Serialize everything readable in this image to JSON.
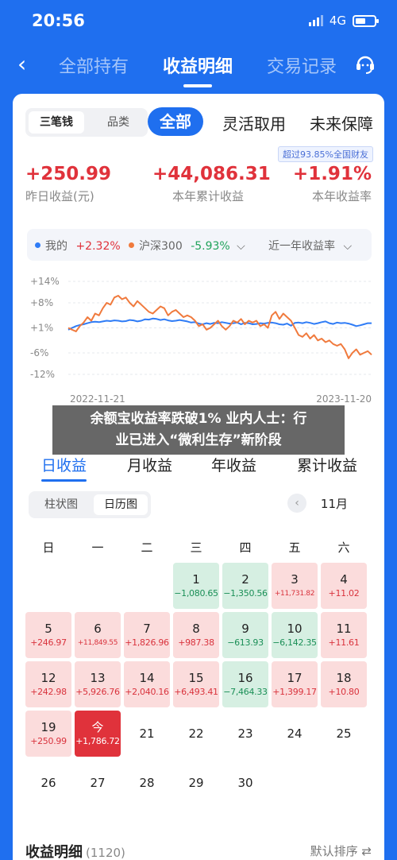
{
  "status": {
    "time": "20:56",
    "network": "4G"
  },
  "nav": {
    "tabs": [
      "全部持有",
      "收益明细",
      "交易记录"
    ],
    "active": 1
  },
  "segment": {
    "options": [
      "三笔钱",
      "品类"
    ],
    "selected": 0
  },
  "filters": [
    "全部",
    "灵活取用",
    "未来保障"
  ],
  "rank_badge": "超过93.85%全国财友",
  "stats": [
    {
      "value": "+250.99",
      "label": "昨日收益(元)"
    },
    {
      "value": "+44,086.31",
      "label": "本年累计收益"
    },
    {
      "value": "+1.91%",
      "label": "本年收益率"
    }
  ],
  "legend": {
    "mine_label": "我的",
    "mine_value": "+2.32%",
    "index_label": "沪深300",
    "index_value": "-5.93%",
    "period": "近一年收益率"
  },
  "colors": {
    "primary": "#1f6fef",
    "up": "#e0323b",
    "down": "#21a35b",
    "mine_line": "#2f7cf6",
    "index_line": "#f07a3d"
  },
  "chart_data": {
    "type": "line",
    "y_ticks": [
      "+14%",
      "+8%",
      "+1%",
      "-6%",
      "-12%"
    ],
    "y_tick_values": [
      14,
      8,
      1,
      -6,
      -12
    ],
    "ylim": [
      -12,
      14
    ],
    "x_labels": [
      "2022-11-21",
      "2023-11-20"
    ],
    "series": [
      {
        "name": "我的",
        "values": [
          0.5,
          1.0,
          1.5,
          1.8,
          2.0,
          2.3,
          2.6,
          2.7,
          2.6,
          2.8,
          3.0,
          2.9,
          3.1,
          3.0,
          2.8,
          2.9,
          3.2,
          3.1,
          2.8,
          3.0,
          3.4,
          3.3,
          3.6,
          3.5,
          3.2,
          3.4,
          3.1,
          2.9,
          3.0,
          3.2,
          3.0,
          2.8,
          2.5,
          2.6,
          2.2,
          2.0,
          2.3,
          2.1,
          2.4,
          2.3,
          2.6,
          2.4,
          2.2,
          2.3,
          2.5,
          2.0,
          2.4,
          2.3,
          2.0,
          2.1,
          2.3,
          2.2,
          2.4,
          2.5,
          2.3,
          2.0,
          1.9,
          2.2,
          1.6,
          2.4,
          2.5,
          2.3,
          2.6,
          2.4,
          2.1,
          2.3,
          2.6,
          2.8,
          2.3,
          2.1,
          2.5,
          2.3,
          2.4,
          2.2,
          1.9,
          1.5,
          1.7,
          2.0,
          2.3,
          2.3
        ]
      },
      {
        "name": "沪深300",
        "values": [
          1.0,
          0.5,
          0.0,
          1.5,
          2.5,
          4.0,
          3.0,
          5.0,
          4.5,
          6.5,
          8.0,
          7.5,
          9.5,
          10.0,
          9.0,
          9.5,
          8.0,
          7.0,
          8.5,
          7.5,
          6.5,
          5.5,
          5.0,
          6.0,
          7.0,
          6.5,
          4.5,
          5.5,
          6.0,
          5.0,
          4.0,
          4.5,
          4.0,
          3.0,
          1.5,
          2.0,
          0.5,
          1.0,
          2.0,
          3.0,
          1.5,
          0.5,
          1.5,
          3.0,
          2.5,
          3.5,
          2.0,
          3.0,
          2.5,
          3.0,
          1.5,
          2.0,
          1.0,
          4.5,
          5.5,
          3.5,
          5.0,
          4.0,
          3.0,
          1.0,
          -1.0,
          -1.5,
          -0.5,
          -2.0,
          -1.0,
          -2.5,
          -2.0,
          -3.0,
          -2.5,
          -3.5,
          -4.0,
          -3.5,
          -5.0,
          -7.5,
          -6.0,
          -5.0,
          -6.5,
          -6.0,
          -5.5,
          -6.5
        ]
      }
    ]
  },
  "banner": {
    "line1": "余额宝收益率跌破1% 业内人士：行",
    "line2": "业已进入“微利生存”新阶段"
  },
  "period_tabs": [
    "日收益",
    "月收益",
    "年收益",
    "累计收益"
  ],
  "view_seg": {
    "options": [
      "柱状图",
      "日历图"
    ],
    "selected": 1
  },
  "month": "11月",
  "weekdays": [
    "日",
    "一",
    "二",
    "三",
    "四",
    "五",
    "六"
  ],
  "calendar": [
    {
      "day": "1",
      "amount": "−1,080.65",
      "type": "dn"
    },
    {
      "day": "2",
      "amount": "−1,350.56",
      "type": "dn"
    },
    {
      "day": "3",
      "amount": "+11,731.82",
      "type": "up",
      "small": true
    },
    {
      "day": "4",
      "amount": "+11.02",
      "type": "up"
    },
    {
      "day": "5",
      "amount": "+246.97",
      "type": "up"
    },
    {
      "day": "6",
      "amount": "+11,849.55",
      "type": "up",
      "small": true
    },
    {
      "day": "7",
      "amount": "+1,826.96",
      "type": "up"
    },
    {
      "day": "8",
      "amount": "+987.38",
      "type": "up"
    },
    {
      "day": "9",
      "amount": "−613.93",
      "type": "dn"
    },
    {
      "day": "10",
      "amount": "−6,142.35",
      "type": "dn"
    },
    {
      "day": "11",
      "amount": "+11.61",
      "type": "up"
    },
    {
      "day": "12",
      "amount": "+242.98",
      "type": "up"
    },
    {
      "day": "13",
      "amount": "+5,926.76",
      "type": "up"
    },
    {
      "day": "14",
      "amount": "+2,040.16",
      "type": "up"
    },
    {
      "day": "15",
      "amount": "+6,493.41",
      "type": "up"
    },
    {
      "day": "16",
      "amount": "−7,464.33",
      "type": "dn"
    },
    {
      "day": "17",
      "amount": "+1,399.17",
      "type": "up"
    },
    {
      "day": "18",
      "amount": "+10.80",
      "type": "up"
    },
    {
      "day": "19",
      "amount": "+250.99",
      "type": "up"
    },
    {
      "day": "今",
      "amount": "+1,786.72",
      "type": "today"
    },
    {
      "day": "21",
      "amount": "",
      "type": "plain"
    },
    {
      "day": "22",
      "amount": "",
      "type": "plain"
    },
    {
      "day": "23",
      "amount": "",
      "type": "plain"
    },
    {
      "day": "24",
      "amount": "",
      "type": "plain"
    },
    {
      "day": "25",
      "amount": "",
      "type": "plain"
    },
    {
      "day": "26",
      "amount": "",
      "type": "plain"
    },
    {
      "day": "27",
      "amount": "",
      "type": "plain"
    },
    {
      "day": "28",
      "amount": "",
      "type": "plain"
    },
    {
      "day": "29",
      "amount": "",
      "type": "plain"
    },
    {
      "day": "30",
      "amount": "",
      "type": "plain"
    }
  ],
  "detail": {
    "title": "收益明细",
    "count": "(1120)",
    "sort": "默认排序 ⇄"
  }
}
